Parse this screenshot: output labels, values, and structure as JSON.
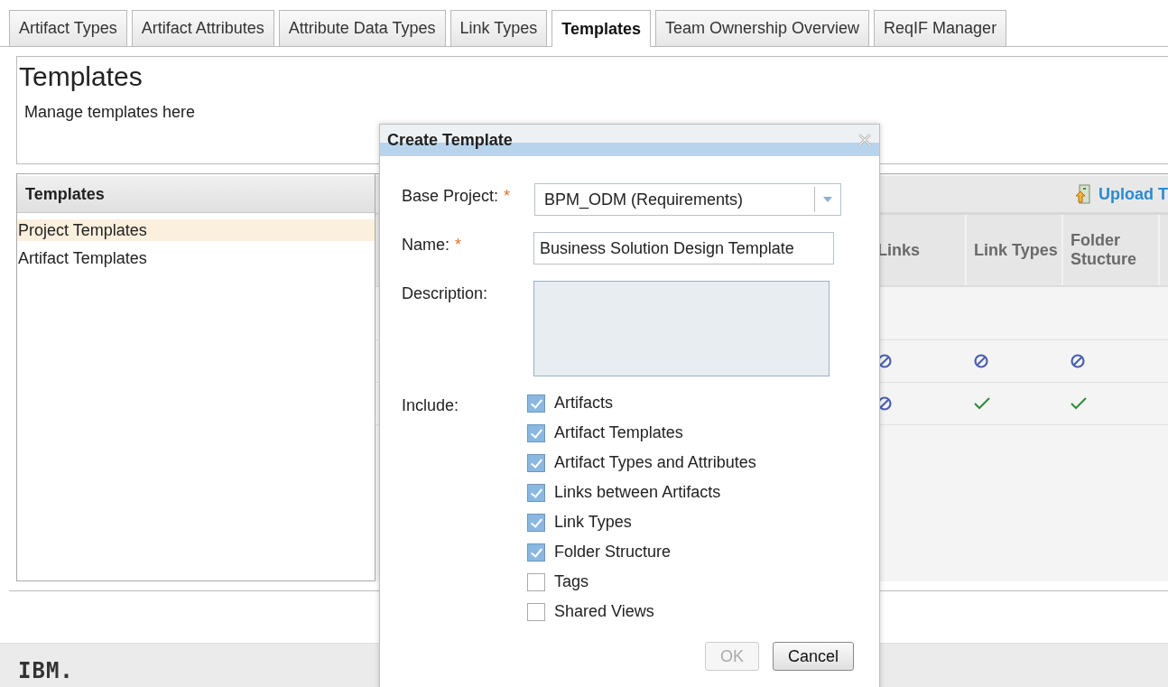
{
  "tabs": [
    {
      "label": "Artifact Types",
      "selected": false
    },
    {
      "label": "Artifact Attributes",
      "selected": false
    },
    {
      "label": "Attribute Data Types",
      "selected": false
    },
    {
      "label": "Link Types",
      "selected": false
    },
    {
      "label": "Templates",
      "selected": true
    },
    {
      "label": "Team Ownership Overview",
      "selected": false
    },
    {
      "label": "ReqIF Manager",
      "selected": false
    }
  ],
  "page": {
    "title": "Templates",
    "subtitle": "Manage templates here"
  },
  "sidebar": {
    "title": "Templates",
    "items": [
      {
        "label": "Project Templates",
        "selected": true
      },
      {
        "label": "Artifact Templates",
        "selected": false
      }
    ]
  },
  "toolbar": {
    "upload_link": "Upload T"
  },
  "table": {
    "columns": [
      "Links",
      "Link Types",
      "Folder Stucture"
    ],
    "rows": [
      {
        "cells": []
      },
      {
        "cells": [
          {
            "included": false
          },
          {
            "included": false
          },
          {
            "included": false
          }
        ]
      },
      {
        "cells": [
          {
            "included": false
          },
          {
            "included": true
          },
          {
            "included": true
          }
        ]
      }
    ]
  },
  "footer": {
    "logo": "IBM."
  },
  "dialog": {
    "title": "Create Template",
    "base_project": {
      "label": "Base Project:",
      "required_mark": "*",
      "value": "BPM_ODM (Requirements)"
    },
    "name": {
      "label": "Name:",
      "required_mark": "*",
      "value": "Business Solution Design Template"
    },
    "description": {
      "label": "Description:"
    },
    "include": {
      "label": "Include:",
      "options": [
        {
          "label": "Artifacts",
          "checked": true
        },
        {
          "label": "Artifact Templates",
          "checked": true
        },
        {
          "label": "Artifact Types and Attributes",
          "checked": true
        },
        {
          "label": "Links between Artifacts",
          "checked": true
        },
        {
          "label": "Link Types",
          "checked": true
        },
        {
          "label": "Folder Structure",
          "checked": true
        },
        {
          "label": "Tags",
          "checked": false
        },
        {
          "label": "Shared Views",
          "checked": false
        }
      ]
    },
    "buttons": [
      {
        "label": "OK",
        "disabled": true
      },
      {
        "label": "Cancel",
        "disabled": false
      }
    ]
  }
}
